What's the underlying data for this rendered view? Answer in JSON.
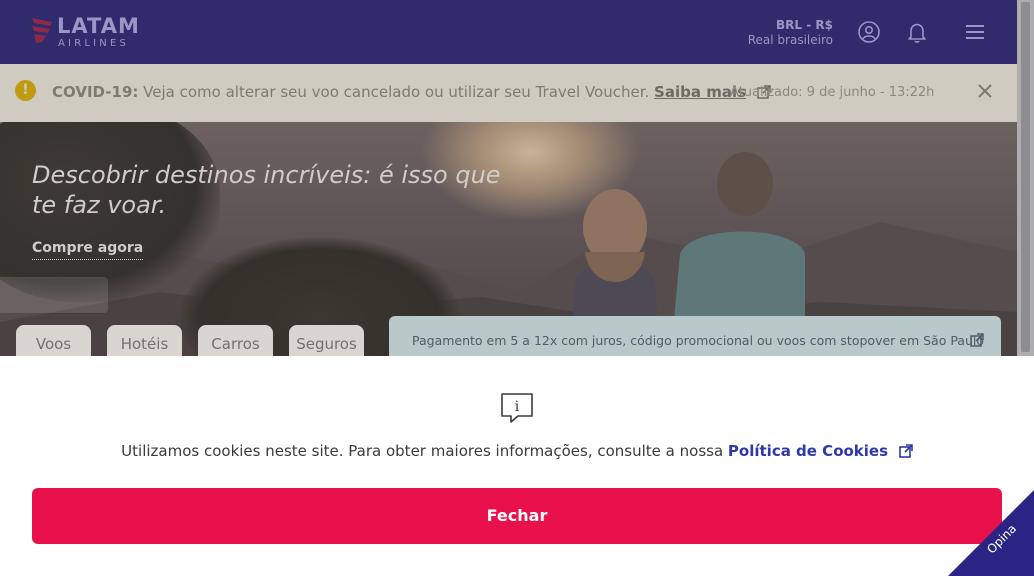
{
  "header": {
    "logo_text": "LATAM",
    "logo_subtext": "AIRLINES",
    "currency_code": "BRL - R$",
    "currency_name": "Real brasileiro",
    "bg_color": "#2f2b6c",
    "icons": [
      "user-icon",
      "bell-icon",
      "menu-icon"
    ]
  },
  "covid_banner": {
    "label": "COVID-19:",
    "message": "Veja como alterar seu voo cancelado ou utilizar seu Travel Voucher.",
    "link": "Saiba mais",
    "updated": "Atualizado: 9 de junho - 13:22h",
    "icons": [
      "alert-icon",
      "external-link-icon",
      "close-icon"
    ]
  },
  "hero": {
    "headline": "Descobrir destinos incríveis: é isso que te faz voar.",
    "cta": "Compre agora"
  },
  "tabs": [
    {
      "label": "Voos"
    },
    {
      "label": "Hotéis"
    },
    {
      "label": "Carros"
    },
    {
      "label": "Seguros"
    }
  ],
  "promo": {
    "text": "Pagamento em 5 a 12x com juros, código promocional ou voos com stopover em São Paulo"
  },
  "cookie": {
    "message": "Utilizamos cookies neste site. Para obter maiores informações, consulte a nossa",
    "policy_link": "Política de Cookies",
    "button": "Fechar",
    "button_color": "#e8114b"
  },
  "opina": {
    "label": "Opina",
    "color": "#2a2585"
  }
}
